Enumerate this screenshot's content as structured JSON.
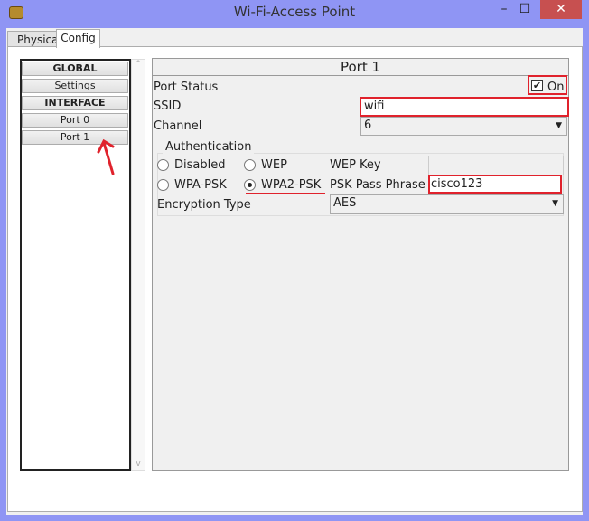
{
  "window": {
    "title": "Wi-Fi-Access Point",
    "minimize": "–",
    "maximize": "☐",
    "close": "✕"
  },
  "tabs": [
    {
      "label": "Physical"
    },
    {
      "label": "Config",
      "active": true
    }
  ],
  "sidebar": {
    "items": [
      {
        "label": "GLOBAL",
        "header": true
      },
      {
        "label": "Settings"
      },
      {
        "label": "INTERFACE",
        "header": true
      },
      {
        "label": "Port 0"
      },
      {
        "label": "Port 1",
        "selected": true
      }
    ],
    "scroll_up": "^",
    "scroll_down": "v"
  },
  "port": {
    "title": "Port 1",
    "port_status_label": "Port Status",
    "port_status_value": "On",
    "port_status_checked": true,
    "ssid_label": "SSID",
    "ssid_value": "wifi",
    "channel_label": "Channel",
    "channel_value": "6",
    "auth": {
      "legend": "Authentication",
      "options": [
        "Disabled",
        "WEP",
        "WPA-PSK",
        "WPA2-PSK"
      ],
      "selected": "WPA2-PSK",
      "wep_key_label": "WEP Key",
      "wep_key_value": "",
      "psk_label": "PSK Pass Phrase",
      "psk_value": "cisco123",
      "encryption_label": "Encryption Type",
      "encryption_value": "AES"
    }
  },
  "colors": {
    "annotation": "#e0222c",
    "titlebar": "#8f95f4"
  }
}
